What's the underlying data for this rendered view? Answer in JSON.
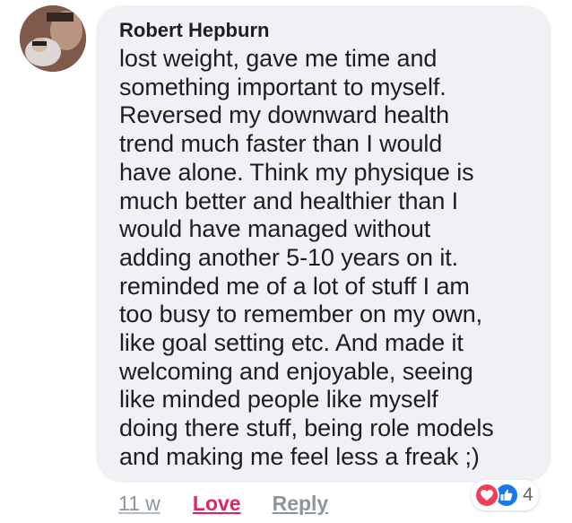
{
  "comment": {
    "author": "Robert Hepburn",
    "lines": [
      "lost weight, gave me time and",
      "something important to myself.",
      "Reversed my downward health",
      "trend much faster than I would",
      "have alone. Think my physique is",
      "much better and healthier than I",
      "would have managed without",
      "adding another 5-10 years on it.",
      "reminded me of a lot of stuff I am",
      "too busy to remember on my own,",
      "like goal setting etc. And made it",
      "welcoming and enjoyable, seeing",
      "like minded people like myself",
      "doing there stuff, being role models",
      "and making me feel less a freak ;)"
    ]
  },
  "actions": {
    "timestamp": "11 w",
    "love_label": "Love",
    "reply_label": "Reply"
  },
  "reactions": {
    "icons": [
      "heart-icon",
      "thumbs-up-icon"
    ],
    "count": "4",
    "love_color": "#f33e58",
    "like_color": "#1877f2",
    "love_active_color": "#e0245e"
  }
}
